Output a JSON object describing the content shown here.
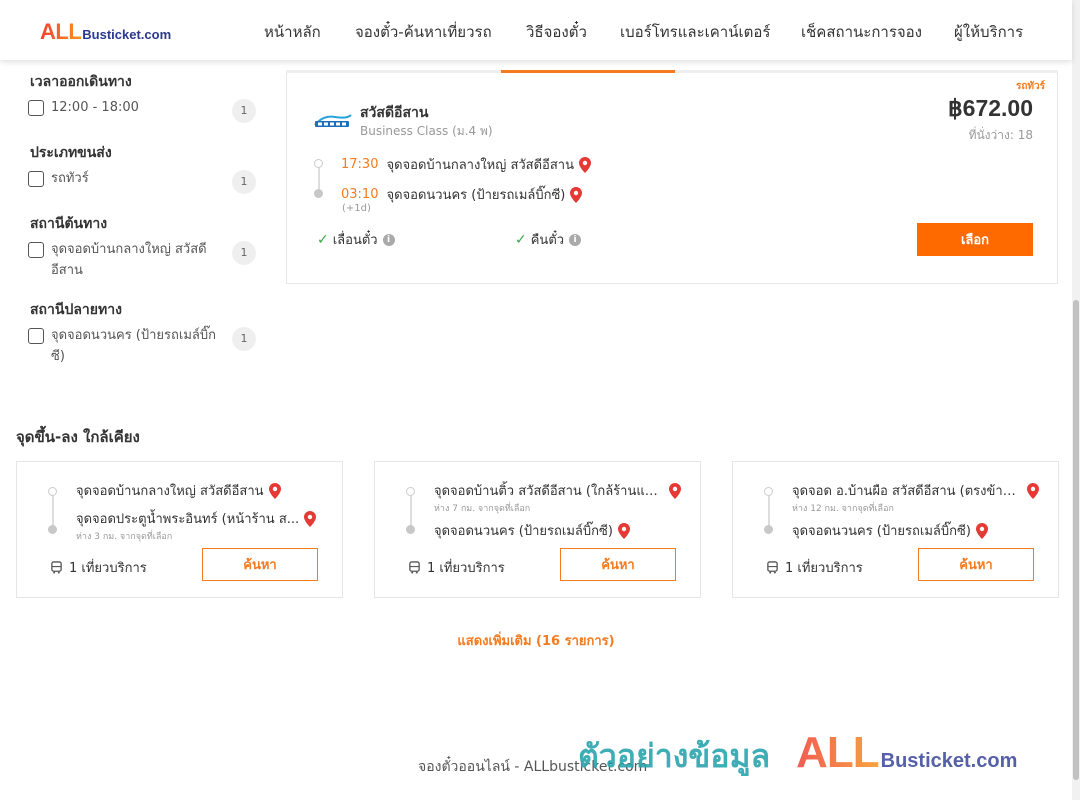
{
  "header": {
    "logo_all": "ALL",
    "logo_rest": "Busticket.com",
    "nav": [
      "หน้าหลัก",
      "จองตั๋ว-ค้นหาเที่ยวรถ",
      "วิธีจองตั๋ว",
      "เบอร์โทรและเคาน์เตอร์",
      "เช็คสถานะการจอง",
      "ผู้ให้บริการ"
    ]
  },
  "filters": [
    {
      "title": "เวลาออกเดินทาง",
      "options": [
        {
          "label": "12:00 - 18:00",
          "count": "1"
        }
      ]
    },
    {
      "title": "ประเภทขนส่ง",
      "options": [
        {
          "label": "รถทัวร์",
          "count": "1"
        }
      ]
    },
    {
      "title": "สถานีต้นทาง",
      "options": [
        {
          "label": "จุดจอดบ้านกลางใหญ่ สวัสดีอีสาน",
          "count": "1"
        }
      ]
    },
    {
      "title": "สถานีปลายทาง",
      "options": [
        {
          "label": "จุดจอดนวนคร (ป้ายรถเมล์บิ๊กซี)",
          "count": "1"
        }
      ]
    }
  ],
  "trip": {
    "ribbon": "รถทัวร์",
    "operator_name": "สวัสดีอีสาน",
    "bus_class": "Business Class (ม.4 พ)",
    "price": "฿672.00",
    "seats": "ที่นั่งว่าง: 18",
    "depart_time": "17:30",
    "depart_stop": "จุดจอดบ้านกลางใหญ่ สวัสดีอีสาน",
    "arrive_time": "03:10",
    "arrive_stop": "จุดจอดนวนคร (ป้ายรถเมล์บิ๊กซี)",
    "next_day": "(+1d)",
    "policy_reschedule": "เลื่อนตั๋ว",
    "policy_refund": "คืนตั๋ว",
    "select_label": "เลือก"
  },
  "nearby": {
    "title": "จุดขึ้น-ลง ใกล้เคียง",
    "cards": [
      {
        "from": "จุดจอดบ้านกลางใหญ่ สวัสดีอีสาน",
        "from_dist": "",
        "to": "จุดจอดประตูน้ำพระอินทร์ (หน้าร้าน ส...",
        "to_dist": "ห่าง 3 กม. จากจุดที่เลือก",
        "trips": "1 เที่ยวบริการ",
        "button": "ค้นหา"
      },
      {
        "from": "จุดจอดบ้านติ้ว สวัสดีอีสาน (ใกล้ร้านแม่...",
        "from_dist": "ห่าง 7 กม. จากจุดที่เลือก",
        "to": "จุดจอดนวนคร (ป้ายรถเมล์บิ๊กซี)",
        "to_dist": "",
        "trips": "1 เที่ยวบริการ",
        "button": "ค้นหา"
      },
      {
        "from": "จุดจอด อ.บ้านผือ สวัสดีอีสาน (ตรงข้าม...",
        "from_dist": "ห่าง 12 กม. จากจุดที่เลือก",
        "to": "จุดจอดนวนคร (ป้ายรถเมล์บิ๊กซี)",
        "to_dist": "",
        "trips": "1 เที่ยวบริการ",
        "button": "ค้นหา"
      }
    ],
    "show_more": "แสดงเพิ่มเติม (16 รายการ)"
  },
  "footer": {
    "text": "จองตั๋วออนไลน์ - ALLbusticket.com"
  },
  "watermark": {
    "thai": "ตัวอย่างข้อมูล",
    "all": "ALL",
    "rest": "Busticket.com"
  },
  "colors": {
    "accent": "#f57b20",
    "button": "#ff6a00",
    "check": "#3aa845",
    "brand_blue": "#2b3990"
  }
}
